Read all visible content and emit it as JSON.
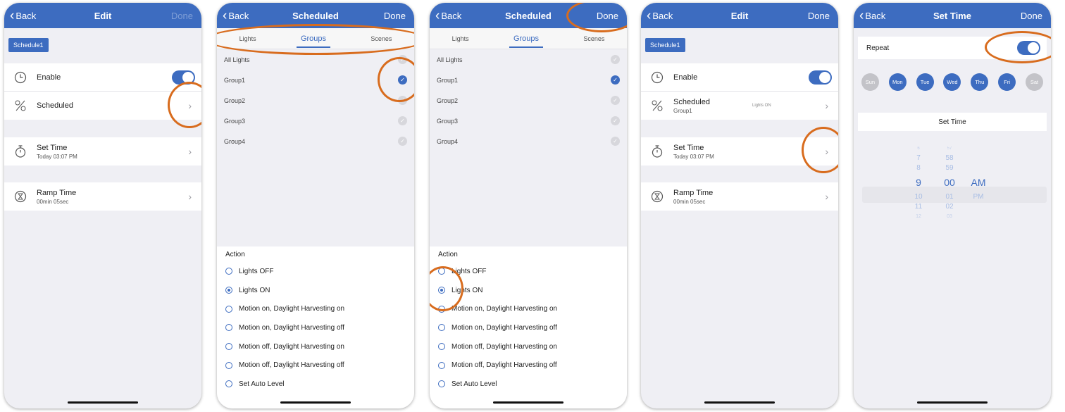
{
  "colors": {
    "accent": "#3d6cc0",
    "annotation": "#d86c1e",
    "background": "#efeff4"
  },
  "phone1": {
    "nav": {
      "back": "Back",
      "title": "Edit",
      "done": "Done"
    },
    "schedule_pill": "Schedule1",
    "enable_label": "Enable",
    "enable_on": true,
    "scheduled_label": "Scheduled",
    "set_time_label": "Set Time",
    "set_time_value": "Today 03:07 PM",
    "ramp_time_label": "Ramp Time",
    "ramp_time_value": "00min 05sec"
  },
  "phone2": {
    "nav": {
      "back": "Back",
      "title": "Scheduled",
      "done": "Done"
    },
    "tabs": [
      "Lights",
      "Groups",
      "Scenes"
    ],
    "active_tab": "Groups",
    "groups": [
      {
        "label": "All Lights",
        "checked": false
      },
      {
        "label": "Group1",
        "checked": true
      },
      {
        "label": "Group2",
        "checked": false
      },
      {
        "label": "Group3",
        "checked": false
      },
      {
        "label": "Group4",
        "checked": false
      }
    ],
    "action_title": "Action",
    "actions": [
      {
        "label": "Lights OFF",
        "selected": false
      },
      {
        "label": "Lights ON",
        "selected": true
      },
      {
        "label": "Motion on, Daylight Harvesting on",
        "selected": false
      },
      {
        "label": "Motion on, Daylight Harvesting off",
        "selected": false
      },
      {
        "label": "Motion off, Daylight Harvesting on",
        "selected": false
      },
      {
        "label": "Motion off, Daylight Harvesting off",
        "selected": false
      },
      {
        "label": "Set Auto Level",
        "selected": false
      }
    ]
  },
  "phone3": {
    "nav": {
      "back": "Back",
      "title": "Scheduled",
      "done": "Done"
    },
    "tabs": [
      "Lights",
      "Groups",
      "Scenes"
    ],
    "groups": [
      "All Lights",
      "Group1",
      "Group2",
      "Group3",
      "Group4"
    ],
    "action_title": "Action",
    "actions": [
      "Lights OFF",
      "Lights ON",
      "Motion on, Daylight Harvesting on",
      "Motion on, Daylight Harvesting off",
      "Motion off, Daylight Harvesting on",
      "Motion off, Daylight Harvesting off",
      "Set Auto Level"
    ]
  },
  "phone4": {
    "nav": {
      "back": "Back",
      "title": "Edit",
      "done": "Done"
    },
    "schedule_pill": "Schedule1",
    "enable_label": "Enable",
    "scheduled_label": "Scheduled",
    "scheduled_group": "Group1",
    "scheduled_action": "Lights ON",
    "set_time_label": "Set Time",
    "set_time_value": "Today 03:07 PM",
    "ramp_time_label": "Ramp Time",
    "ramp_time_value": "00min 05sec"
  },
  "phone5": {
    "nav": {
      "back": "Back",
      "title": "Set Time",
      "done": "Done"
    },
    "repeat_label": "Repeat",
    "repeat_on": true,
    "days": [
      {
        "label": "Sun",
        "on": false
      },
      {
        "label": "Mon",
        "on": true
      },
      {
        "label": "Tue",
        "on": true
      },
      {
        "label": "Wed",
        "on": true
      },
      {
        "label": "Thu",
        "on": true
      },
      {
        "label": "Fri",
        "on": true
      },
      {
        "label": "Sat",
        "on": false
      }
    ],
    "set_time_header": "Set Time",
    "picker": {
      "hours": [
        "6",
        "7",
        "8",
        "9",
        "10",
        "11",
        "12"
      ],
      "minutes": [
        "57",
        "58",
        "59",
        "00",
        "01",
        "02",
        "03"
      ],
      "ampm": [
        "AM",
        "PM"
      ],
      "selected_hour": "9",
      "selected_minute": "00",
      "selected_ampm": "AM"
    }
  }
}
